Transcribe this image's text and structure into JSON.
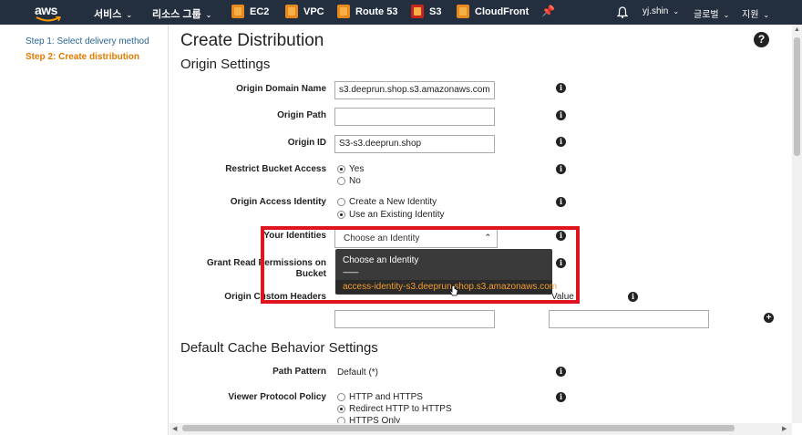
{
  "topnav": {
    "logo": "aws",
    "services_label": "서비스",
    "resource_groups_label": "리소스 그룹",
    "services": [
      {
        "label": "EC2"
      },
      {
        "label": "VPC"
      },
      {
        "label": "Route 53"
      },
      {
        "label": "S3"
      },
      {
        "label": "CloudFront"
      }
    ],
    "user": "yj.shin",
    "region": "글로벌",
    "support": "지원"
  },
  "sidebar": {
    "steps": [
      {
        "label": "Step 1: Select delivery method"
      },
      {
        "label": "Step 2: Create distribution"
      }
    ]
  },
  "main": {
    "title": "Create Distribution",
    "origin_settings_heading": "Origin Settings",
    "origin_domain_name": {
      "label": "Origin Domain Name",
      "value": "s3.deeprun.shop.s3.amazonaws.com"
    },
    "origin_path": {
      "label": "Origin Path",
      "value": ""
    },
    "origin_id": {
      "label": "Origin ID",
      "value": "S3-s3.deeprun.shop"
    },
    "restrict_bucket_access": {
      "label": "Restrict Bucket Access",
      "options": [
        "Yes",
        "No"
      ],
      "selected": "Yes"
    },
    "origin_access_identity": {
      "label": "Origin Access Identity",
      "options": [
        "Create a New Identity",
        "Use an Existing Identity"
      ],
      "selected": "Use an Existing Identity"
    },
    "your_identities": {
      "label": "Your Identities",
      "value": "Choose an Identity",
      "dropdown_options": [
        "Choose an Identity",
        "----------",
        "access-identity-s3.deeprun.shop.s3.amazonaws.com"
      ]
    },
    "grant_read_permissions": {
      "label_line1": "Grant Read Permissions on",
      "label_line2": "Bucket"
    },
    "origin_custom_headers": {
      "label": "Origin Custom Headers",
      "value_col": "Value"
    },
    "default_cache_heading": "Default Cache Behavior Settings",
    "path_pattern": {
      "label": "Path Pattern",
      "value": "Default (*)"
    },
    "viewer_protocol_policy": {
      "label": "Viewer Protocol Policy",
      "options": [
        "HTTP and HTTPS",
        "Redirect HTTP to HTTPS",
        "HTTPS Only"
      ],
      "selected": "Redirect HTTP to HTTPS"
    }
  },
  "colors": {
    "nav_bg": "#232f3e",
    "highlight_border": "#e0141e",
    "active_step": "#e07b00",
    "link": "#2a6496",
    "dropdown_highlight_text": "#f39c2d"
  }
}
